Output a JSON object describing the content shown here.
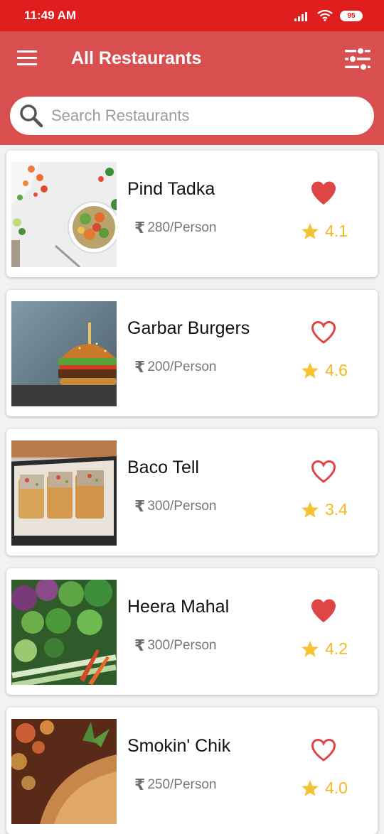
{
  "status_bar": {
    "time": "11:49 AM",
    "battery": "95"
  },
  "app_bar": {
    "title": "All Restaurants"
  },
  "search": {
    "placeholder": "Search Restaurants"
  },
  "colors": {
    "brand": "#d94f4f",
    "status": "#e01e1e",
    "heart": "#e04545",
    "star": "#f5c232"
  },
  "restaurants": [
    {
      "name": "Pind Tadka",
      "price": "280/Person",
      "rating": "4.1",
      "favorite": true,
      "image": "salad-bowl"
    },
    {
      "name": "Garbar Burgers",
      "price": "200/Person",
      "rating": "4.6",
      "favorite": false,
      "image": "burger"
    },
    {
      "name": "Baco Tell",
      "price": "300/Person",
      "rating": "3.4",
      "favorite": false,
      "image": "tacos"
    },
    {
      "name": "Heera Mahal",
      "price": "300/Person",
      "rating": "4.2",
      "favorite": true,
      "image": "vegetables"
    },
    {
      "name": "Smokin' Chik",
      "price": "250/Person",
      "rating": "4.0",
      "favorite": false,
      "image": "roast-chicken"
    }
  ]
}
